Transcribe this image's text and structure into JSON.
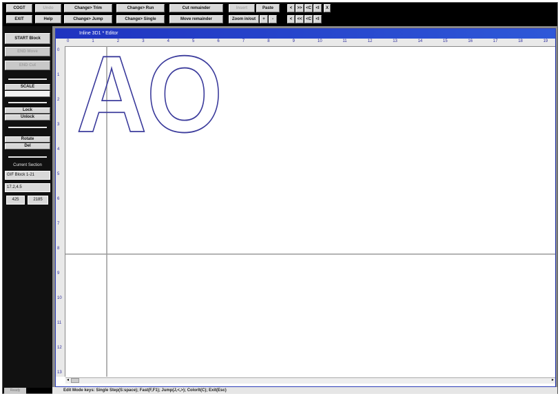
{
  "toolbar": {
    "row1": [
      "COGT",
      "Undo",
      "Change> Trim",
      "Change> Run",
      "Cut remainder",
      "Insert",
      "Paste",
      "<",
      ">>",
      "<C",
      "<I",
      "X"
    ],
    "row2": [
      "EXIT",
      "Help",
      "Change> Jump",
      "Change> Single",
      "Move remainder",
      "Zoom in/out",
      "+",
      "-",
      "<",
      "<<",
      "<C",
      "<I"
    ]
  },
  "left_panel": {
    "start_block": "START Block",
    "end_move": "END Move",
    "end_cut": "END Cut",
    "scale": "SCALE",
    "scale_value": "",
    "lock": "Lock",
    "unlock": "Unlock",
    "rotate": "Rotate",
    "del": "Del",
    "current_section_label": "Current Section",
    "section_name": "GIF Block 1-21",
    "coords": "17.2,4.5",
    "val1": "425",
    "val2": "2185"
  },
  "window": {
    "title": "Inline 3D1 * Editor",
    "hruler": [
      "0",
      "1",
      "2",
      "3",
      "4",
      "5",
      "6",
      "7",
      "8",
      "9",
      "10",
      "11",
      "12",
      "13",
      "14",
      "15",
      "16",
      "17",
      "18",
      "19"
    ],
    "vruler": [
      "0",
      "1",
      "2",
      "3",
      "4",
      "5",
      "6",
      "7",
      "8",
      "9",
      "10",
      "11",
      "12",
      "13"
    ],
    "canvas_text": "AO"
  },
  "status": {
    "left": "Ready",
    "text": "Edit Mode keys: Single Step(S:space); Fast(F,F1); Jump(J,<,>); ColorIt(C); Exit(Esc)"
  },
  "colors": {
    "outline": "#3c3c9c",
    "title_bar": "#1f33c0"
  }
}
